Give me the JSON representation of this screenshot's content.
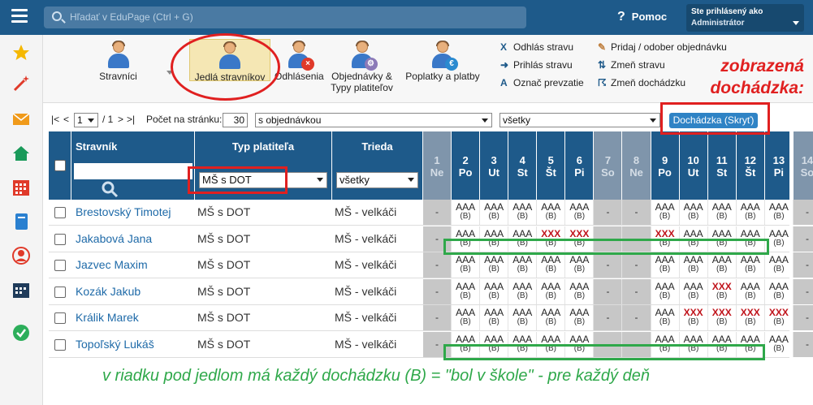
{
  "search": {
    "placeholder": "Hľadať v EduPage (Ctrl + G)"
  },
  "help": {
    "label": "Pomoc"
  },
  "user": {
    "line1": "Ste prihlásený ako",
    "line2": "Administrátor"
  },
  "toolbar": {
    "buttons": [
      "Stravníci",
      "Jedlá stravníkov",
      "Odhlásenia",
      "Objednávky &",
      "Typy platiteľov",
      "Poplatky a platby"
    ],
    "actions": [
      "Odhlás stravu",
      "Prihlás stravu",
      "Označ prevzatie",
      "Pridaj / odober objednávku",
      "Zmeň stravu",
      "Zmeň dochádzku"
    ]
  },
  "annotation": {
    "line1": "zobrazená",
    "line2": "dochádzka:",
    "bottom": "v riadku pod jedlom má každý dochádzku (B) = \"bol v škole\" - pre každý deň"
  },
  "pager": {
    "first": "|<",
    "prev": "<",
    "page": "1",
    "of": "/ 1",
    "next": ">",
    "last": ">|",
    "per_page_label": "Počet na stránku:",
    "per_page": "30",
    "filter1": "s objednávkou",
    "filter2": "všetky",
    "toggle_button": "Dochádzka (Skryť)"
  },
  "table": {
    "h_name": "Stravník",
    "h_type": "Typ platiteľa",
    "h_class": "Trieda",
    "type_filter": "MŠ s DOT",
    "class_filter": "všetky",
    "days": [
      {
        "n": "1",
        "d": "Ne",
        "we": true
      },
      {
        "n": "2",
        "d": "Po",
        "we": false
      },
      {
        "n": "3",
        "d": "Ut",
        "we": false
      },
      {
        "n": "4",
        "d": "St",
        "we": false
      },
      {
        "n": "5",
        "d": "Št",
        "we": false
      },
      {
        "n": "6",
        "d": "Pi",
        "we": false
      },
      {
        "n": "7",
        "d": "So",
        "we": true
      },
      {
        "n": "8",
        "d": "Ne",
        "we": true
      },
      {
        "n": "9",
        "d": "Po",
        "we": false
      },
      {
        "n": "10",
        "d": "Ut",
        "we": false
      },
      {
        "n": "11",
        "d": "St",
        "we": false
      },
      {
        "n": "12",
        "d": "Št",
        "we": false
      },
      {
        "n": "13",
        "d": "Pi",
        "we": false
      },
      {
        "n": "14",
        "d": "So",
        "we": true
      }
    ],
    "meal": "AAA",
    "meal_off": "XXX",
    "attendance": "(B)",
    "dash": "-",
    "rows": [
      {
        "name": "Brestovský Timotej",
        "type": "MŠ s DOT",
        "class": "MŠ - velkáči",
        "x": []
      },
      {
        "name": "Jakabová Jana",
        "type": "MŠ s DOT",
        "class": "MŠ - velkáči",
        "x": [
          "5",
          "6",
          "9"
        ]
      },
      {
        "name": "Jazvec Maxim",
        "type": "MŠ s DOT",
        "class": "MŠ - velkáči",
        "x": []
      },
      {
        "name": "Kozák Jakub",
        "type": "MŠ s DOT",
        "class": "MŠ - velkáči",
        "x": [
          "11"
        ]
      },
      {
        "name": "Králik Marek",
        "type": "MŠ s DOT",
        "class": "MŠ - velkáči",
        "x": [
          "10",
          "11",
          "12",
          "13"
        ]
      },
      {
        "name": "Topoľský Lukáš",
        "type": "MŠ s DOT",
        "class": "MŠ - velkáči",
        "x": []
      }
    ]
  },
  "colors": {
    "brand": "#1e5a8a",
    "annotation_red": "#e02020",
    "annotation_green": "#2fa84a",
    "absent": "#c0141c"
  }
}
